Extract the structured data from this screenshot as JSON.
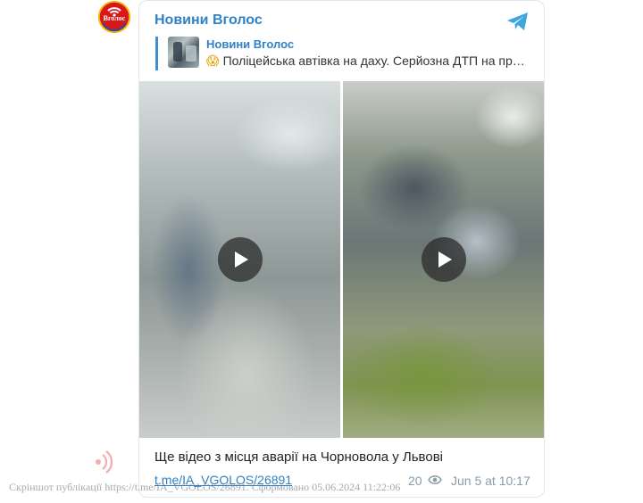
{
  "channel": {
    "name": "Новини Вголос",
    "avatar_text": "Вголос",
    "brand_color": "#d7191a",
    "accent_color": "#2f82c5"
  },
  "reply": {
    "title": "Новини Вголос",
    "emoji": "😱",
    "text": "Поліцейська автівка на даху. Серйозна ДТП на пр…"
  },
  "media": {
    "videos": [
      {
        "type": "video",
        "icon": "play-icon"
      },
      {
        "type": "video",
        "icon": "play-icon"
      }
    ]
  },
  "post": {
    "caption": "Ще відео з місця аварії на Чорновола у Львові",
    "link": "t.me/IA_VGOLOS/26891",
    "views": "20",
    "date": "Jun 5 at 10:17"
  },
  "watermark": {
    "text": "Скріншот публікації https://t.me/IA_VGOLOS/26891. Сформовано 05.06.2024 11:22:06"
  }
}
